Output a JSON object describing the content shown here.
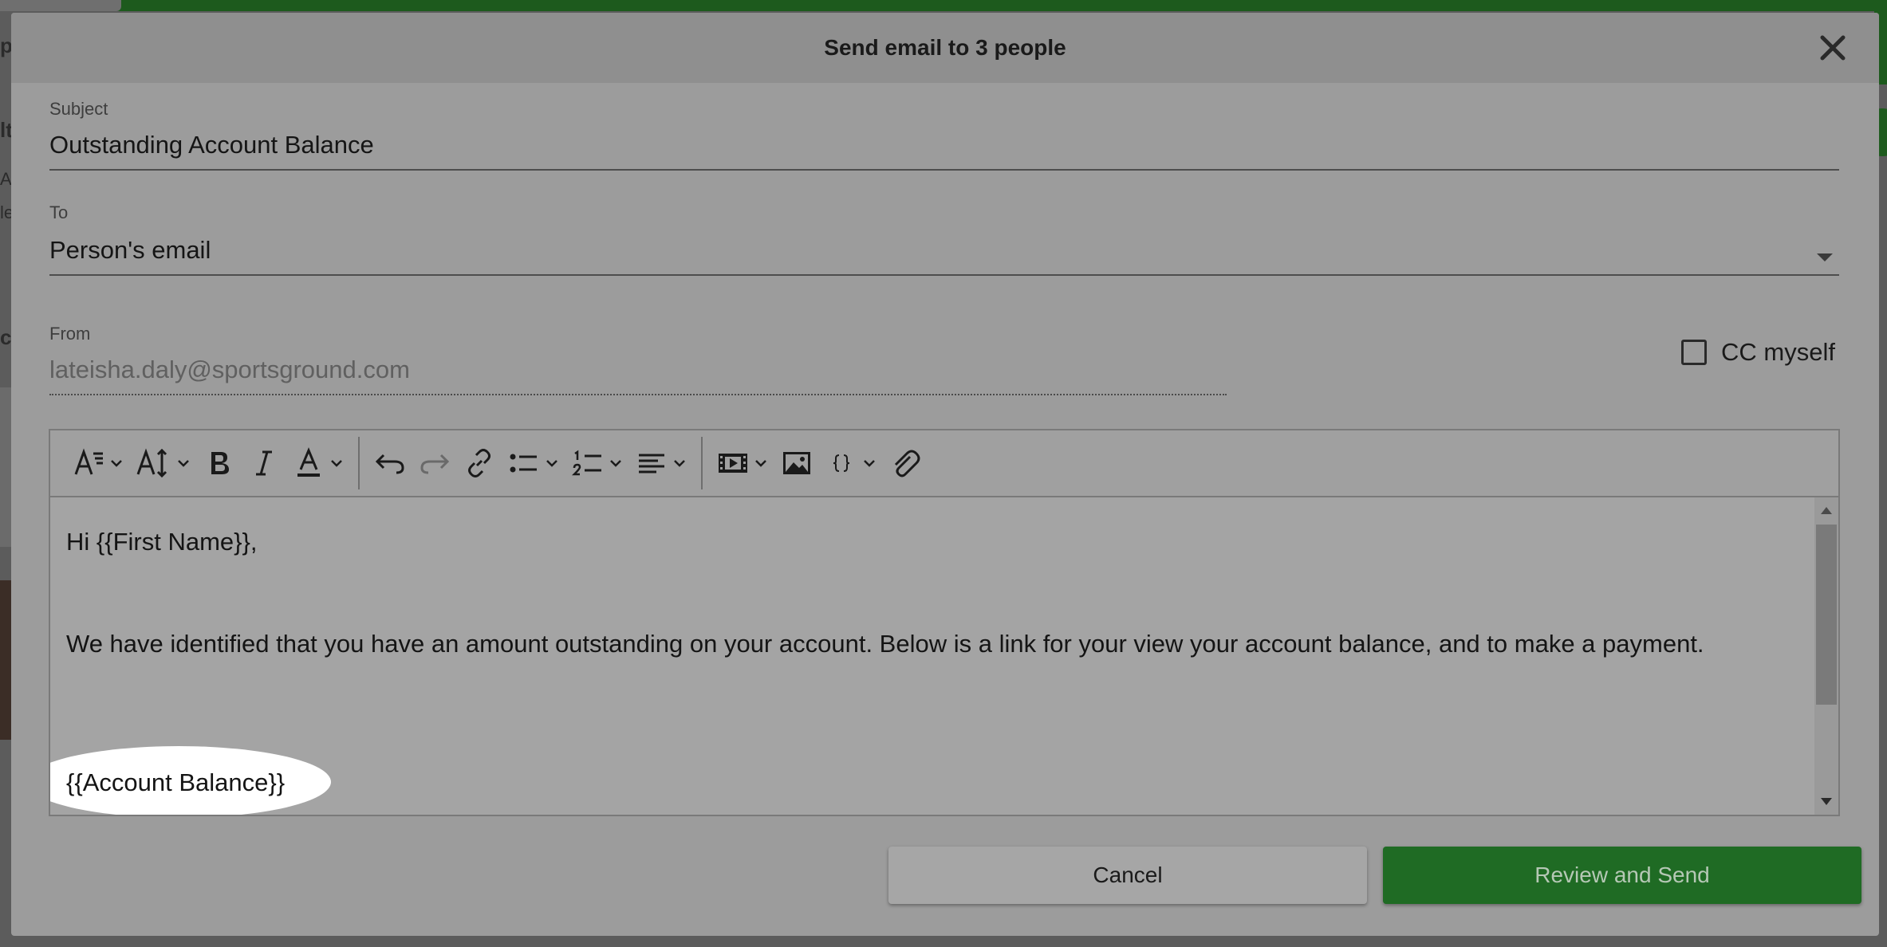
{
  "background": {
    "left_glyphs": [
      "p",
      "lt",
      "A",
      "le",
      "c"
    ]
  },
  "modal": {
    "title": "Send email to 3 people",
    "subject": {
      "label": "Subject",
      "value": "Outstanding Account Balance"
    },
    "to": {
      "label": "To",
      "value": "Person's email"
    },
    "from": {
      "label": "From",
      "value": "lateisha.daly@sportsground.com"
    },
    "cc_myself": {
      "label": "CC myself",
      "checked": false
    },
    "toolbar": {
      "icons": [
        "font-family-icon",
        "font-size-icon",
        "bold-icon",
        "italic-icon",
        "text-color-icon",
        "undo-icon",
        "redo-icon",
        "link-icon",
        "bullet-list-icon",
        "numbered-list-icon",
        "align-icon",
        "video-icon",
        "image-icon",
        "merge-field-icon",
        "attachment-icon"
      ]
    },
    "body": {
      "greeting": "Hi {{First Name}},",
      "paragraph": "We have identified that you have an amount outstanding on your account. Below is a link for your view your account balance, and to make a payment.",
      "balance_field": "{{Account Balance}}"
    },
    "buttons": {
      "cancel": "Cancel",
      "send": "Review and Send"
    },
    "colors": {
      "primary": "#1f6b24",
      "overlay": "#9c9c9c"
    }
  }
}
